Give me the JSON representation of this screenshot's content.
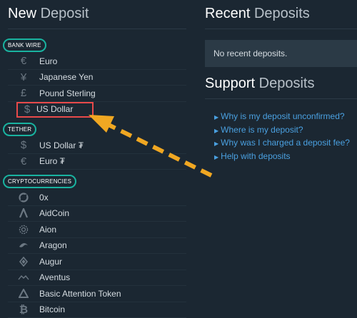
{
  "deposit": {
    "title_strong": "New",
    "title_dim": "Deposit",
    "sections": [
      {
        "label": "BANK WIRE",
        "items": [
          {
            "label": "Euro",
            "icon": "euro-icon"
          },
          {
            "label": "Japanese Yen",
            "icon": "yen-icon"
          },
          {
            "label": "Pound Sterling",
            "icon": "pound-icon"
          },
          {
            "label": "US Dollar",
            "icon": "dollar-icon",
            "highlighted": true
          }
        ]
      },
      {
        "label": "TETHER",
        "items": [
          {
            "label": "US Dollar ₮",
            "icon": "dollar-icon"
          },
          {
            "label": "Euro ₮",
            "icon": "euro-icon"
          }
        ]
      },
      {
        "label": "CRYPTOCURRENCIES",
        "items": [
          {
            "label": "0x",
            "icon": "zrx-icon"
          },
          {
            "label": "AidCoin",
            "icon": "aidcoin-icon"
          },
          {
            "label": "Aion",
            "icon": "aion-icon"
          },
          {
            "label": "Aragon",
            "icon": "aragon-icon"
          },
          {
            "label": "Augur",
            "icon": "augur-icon"
          },
          {
            "label": "Aventus",
            "icon": "aventus-icon"
          },
          {
            "label": "Basic Attention Token",
            "icon": "bat-icon"
          },
          {
            "label": "Bitcoin",
            "icon": "bitcoin-icon"
          }
        ]
      }
    ]
  },
  "recent": {
    "title_strong": "Recent",
    "title_dim": "Deposits",
    "empty_text": "No recent deposits."
  },
  "support": {
    "title_strong": "Support",
    "title_dim": "Deposits",
    "links": [
      "Why is my deposit unconfirmed?",
      "Where is my deposit?",
      "Why was I charged a deposit fee?",
      "Help with deposits"
    ]
  },
  "colors": {
    "background": "#1b2732",
    "label_outline": "#19b3a0",
    "highlight_box": "#e84a4a",
    "arrow": "#f0a722",
    "link": "#4aa0e0"
  }
}
